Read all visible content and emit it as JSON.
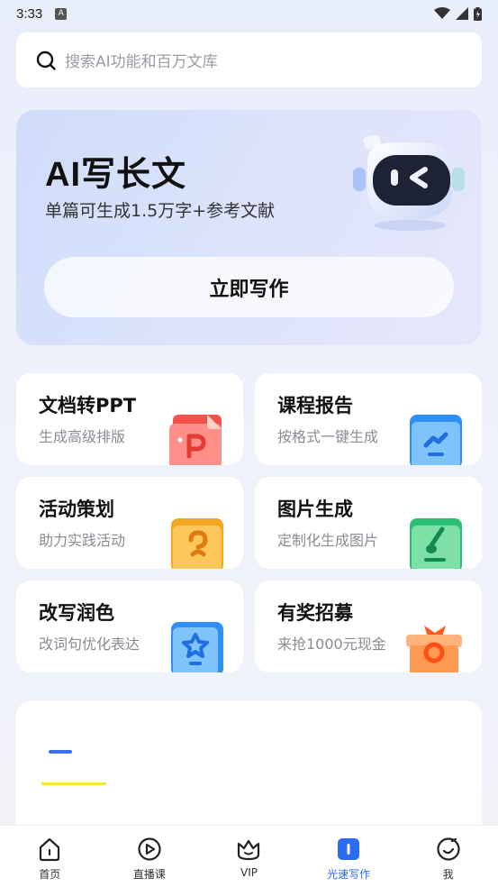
{
  "status_bar": {
    "time": "3:33"
  },
  "search": {
    "placeholder": "搜索AI功能和百万文库"
  },
  "hero": {
    "title": "AI写长文",
    "subtitle": "单篇可生成1.5万字+参考文献",
    "button_label": "立即写作"
  },
  "cards": [
    {
      "title": "文档转PPT",
      "subtitle": "生成高级排版",
      "icon": "ppt-icon",
      "color": "#f2524a"
    },
    {
      "title": "课程报告",
      "subtitle": "按格式一键生成",
      "icon": "chart-folder-icon",
      "color": "#2f8ff5"
    },
    {
      "title": "活动策划",
      "subtitle": "助力实践活动",
      "icon": "activity-icon",
      "color": "#f5a623"
    },
    {
      "title": "图片生成",
      "subtitle": "定制化生成图片",
      "icon": "brush-icon",
      "color": "#2bbf73"
    },
    {
      "title": "改写润色",
      "subtitle": "改词句优化表达",
      "icon": "star-book-icon",
      "color": "#2f8ff5"
    },
    {
      "title": "有奖招募",
      "subtitle": "来抢1000元现金",
      "icon": "gift-icon",
      "color": "#ff7a3c"
    }
  ],
  "tabbar": {
    "items": [
      {
        "label": "首页",
        "icon": "home-icon"
      },
      {
        "label": "直播课",
        "icon": "play-icon"
      },
      {
        "label": "VIP",
        "icon": "crown-icon"
      },
      {
        "label": "光速写作",
        "icon": "writing-icon",
        "active": true
      },
      {
        "label": "我",
        "icon": "profile-icon"
      }
    ]
  },
  "colors": {
    "accent": "#2c6cf2",
    "hero_bg": "#d6e0fb",
    "page_bg": "#eef1fb"
  }
}
